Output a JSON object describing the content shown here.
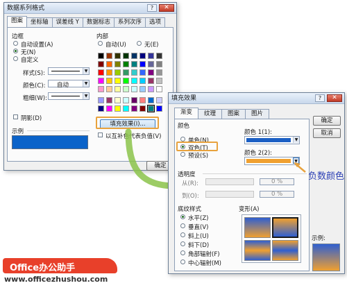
{
  "dialog1": {
    "title": "数据系列格式",
    "tabs": [
      "图案",
      "坐标轴",
      "误差线 Y",
      "数据标志",
      "系列次序",
      "选项"
    ],
    "border_section": {
      "title": "边框",
      "radios": [
        "自动设置(A)",
        "无(N)",
        "自定义"
      ],
      "selected": "无(N)",
      "style_label": "样式(S):",
      "color_label": "颜色(C):",
      "color_value": "自动",
      "weight_label": "粗细(W):",
      "shadow_label": "阴影(D)"
    },
    "sample_label": "示例",
    "sample_color": "#0b63c9",
    "interior_section": {
      "title": "内部",
      "auto_label": "自动(U)",
      "none_label": "无(E)",
      "fill_effects_button": "填充效果(I)...",
      "invert_label": "以互补色代表负值(V)"
    },
    "ok_button": "确定"
  },
  "palette": [
    [
      "#000000",
      "#993300",
      "#333300",
      "#003300",
      "#003366",
      "#000080",
      "#333399",
      "#333333"
    ],
    [
      "#800000",
      "#ff6600",
      "#808000",
      "#008000",
      "#008080",
      "#0000ff",
      "#666699",
      "#808080"
    ],
    [
      "#ff0000",
      "#ff9900",
      "#99cc00",
      "#339966",
      "#33cccc",
      "#3366ff",
      "#800080",
      "#969696"
    ],
    [
      "#ff00ff",
      "#ffcc00",
      "#ffff00",
      "#00ff00",
      "#00ffff",
      "#00ccff",
      "#993366",
      "#c0c0c0"
    ],
    [
      "#ff99cc",
      "#ffcc99",
      "#ffff99",
      "#ccffcc",
      "#ccffff",
      "#99ccff",
      "#cc99ff",
      "#ffffff"
    ],
    [
      "#9999ff",
      "#993366",
      "#ffffcc",
      "#ccffff",
      "#660066",
      "#ff8080",
      "#0066cc",
      "#ccccff"
    ],
    [
      "#000080",
      "#ff00ff",
      "#ffff00",
      "#00ffff",
      "#800080",
      "#800000",
      "#008080",
      "#0000ff"
    ]
  ],
  "dialog2": {
    "title": "填充效果",
    "tabs": [
      "渐变",
      "纹理",
      "图案",
      "图片"
    ],
    "colors_section": {
      "title": "颜色",
      "radios": [
        "单色(N)",
        "双色(T)",
        "预设(S)"
      ],
      "selected": "双色(T)",
      "color1_label": "颜色 1(1):",
      "color1_value": "#1b5fc4",
      "color2_label": "颜色 2(2):",
      "color2_value": "#f0a030"
    },
    "transparency_section": {
      "title": "透明度",
      "from_label": "从(R):",
      "to_label": "到(O):",
      "from_value": "0 %",
      "to_value": "0 %"
    },
    "shading_section": {
      "title": "底纹样式",
      "radios": [
        "水平(Z)",
        "垂直(V)",
        "斜上(U)",
        "斜下(D)",
        "角部辐射(F)",
        "中心辐射(M)"
      ],
      "selected": "水平(Z)",
      "variants_title": "变形(A)"
    },
    "sample_label": "示例:",
    "ok_button": "确定",
    "cancel_button": "取消"
  },
  "annotation": {
    "text": "负数颜色",
    "color": "#2b3fb5"
  },
  "watermark": {
    "brand": "Office办公助手",
    "url": "www.officezhushou.com"
  }
}
